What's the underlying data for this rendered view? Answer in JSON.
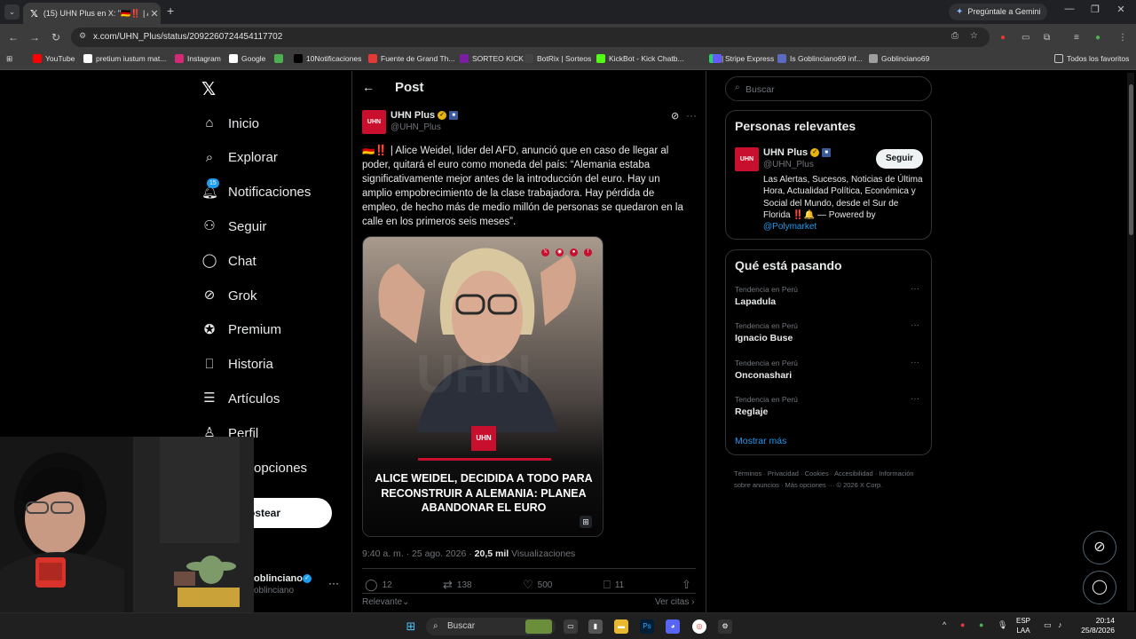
{
  "browser": {
    "tab_title": "(15) UHN Plus en X: \"🇩🇪‼️ | Ali",
    "gemini_label": "Pregúntale a Gemini",
    "url": "x.com/UHN_Plus/status/2092260724454117702",
    "bookmarks": [
      {
        "label": "YouTube",
        "color": "#ff0000",
        "icon": "youtube-icon"
      },
      {
        "label": "pretium iustum mat...",
        "color": "#ffffff",
        "icon": "google-icon"
      },
      {
        "label": "Instagram",
        "color": "#d62976",
        "icon": "instagram-icon"
      },
      {
        "label": "Google",
        "color": "#ffffff",
        "icon": "google-icon"
      },
      {
        "label": "",
        "color": "#4caf50",
        "icon": "leaf-icon"
      },
      {
        "label": "10Notificaciones",
        "color": "#000000",
        "icon": "x-icon"
      },
      {
        "label": "Fuente de Grand Th...",
        "color": "#e53935",
        "icon": "font-icon"
      },
      {
        "label": "SORTEO KICK",
        "color": "#7b1fa2",
        "icon": "gift-icon"
      },
      {
        "label": "BotRix | Sorteos",
        "color": "#444444",
        "icon": "bot-icon"
      },
      {
        "label": "KickBot - Kick Chatb...",
        "color": "#53fc18",
        "icon": "kick-icon"
      },
      {
        "label": "|",
        "color": "#25d366",
        "icon": "whatsapp-icon"
      },
      {
        "label": "Stripe Express",
        "color": "#635bff",
        "icon": "stripe-icon"
      },
      {
        "label": "Is Goblinciano69 inf...",
        "color": "#5c6bc0",
        "icon": "bank-icon"
      },
      {
        "label": "Goblinciano69",
        "color": "#9e9e9e",
        "icon": "globe-icon"
      }
    ],
    "all_bookmarks": "Todos los favoritos"
  },
  "nav": {
    "items": [
      {
        "label": "Inicio",
        "icon": "home-icon"
      },
      {
        "label": "Explorar",
        "icon": "search-icon"
      },
      {
        "label": "Notificaciones",
        "icon": "bell-icon",
        "badge": "15"
      },
      {
        "label": "Seguir",
        "icon": "follow-icon"
      },
      {
        "label": "Chat",
        "icon": "chat-icon"
      },
      {
        "label": "Grok",
        "icon": "grok-icon"
      },
      {
        "label": "Premium",
        "icon": "premium-icon"
      },
      {
        "label": "Historia",
        "icon": "bookmark-icon"
      },
      {
        "label": "Artículos",
        "icon": "articles-icon"
      },
      {
        "label": "Perfil",
        "icon": "profile-icon"
      },
      {
        "label": "opciones",
        "icon": "more-icon"
      }
    ],
    "post_button": "ostear",
    "account_name": "oblinciano",
    "account_handle": "oblinciano"
  },
  "post": {
    "header": "Post",
    "author_name": "UHN Plus",
    "author_handle": "@UHN_Plus",
    "avatar_text": "UHN",
    "text": "🇩🇪‼️ | Alice Weidel, líder del AFD, anunció que en caso de llegar al poder, quitará el euro como moneda del país: “Alemania estaba significativamente mejor antes de la introducción del euro. Hay un amplio empobrecimiento de la clase trabajadora. Hay pérdida de empleo, de hecho más de medio millón de personas se quedaron en la calle en los primeros seis meses”.",
    "image_caption": "ALICE WEIDEL, DECIDIDA A TODO PARA RECONSTRUIR A ALEMANIA: PLANEA ABANDONAR EL EURO",
    "image_logo": "UHN",
    "image_watermark": "UHN",
    "time": "9:40 a. m. · 25 ago. 2026 · ",
    "views": "20,5 mil",
    "views_label": " Visualizaciones",
    "replies": "12",
    "reposts": "138",
    "likes": "500",
    "bookmarks": "11",
    "sort_label": "Relevante",
    "quotes_label": "Ver citas"
  },
  "sidebar": {
    "search_placeholder": "Buscar",
    "relevant_title": "Personas relevantes",
    "relevant": {
      "name": "UHN Plus",
      "handle": "@UHN_Plus",
      "follow": "Seguir",
      "bio": "Las Alertas, Sucesos, Noticias de Última Hora, Actualidad Política, Económica y Social del Mundo, desde el Sur de Florida ‼️🔔 — Powered by ",
      "bio_link": "@Polymarket"
    },
    "trends_title": "Qué está pasando",
    "trends": [
      {
        "context": "Tendencia en Perú",
        "name": "Lapadula"
      },
      {
        "context": "Tendencia en Perú",
        "name": "Ignacio Buse"
      },
      {
        "context": "Tendencia en Perú",
        "name": "Onconashari"
      },
      {
        "context": "Tendencia en Perú",
        "name": "Reglaje"
      }
    ],
    "show_more": "Mostrar más",
    "footer": "Términos · Privacidad · Cookies · Accesibilidad · Información sobre anuncios · Más opciones ··· © 2026 X Corp."
  },
  "taskbar": {
    "search": "Buscar",
    "lang_line1": "ESP",
    "lang_line2": "LAA",
    "time": "20:14",
    "date": "25/8/2026"
  }
}
